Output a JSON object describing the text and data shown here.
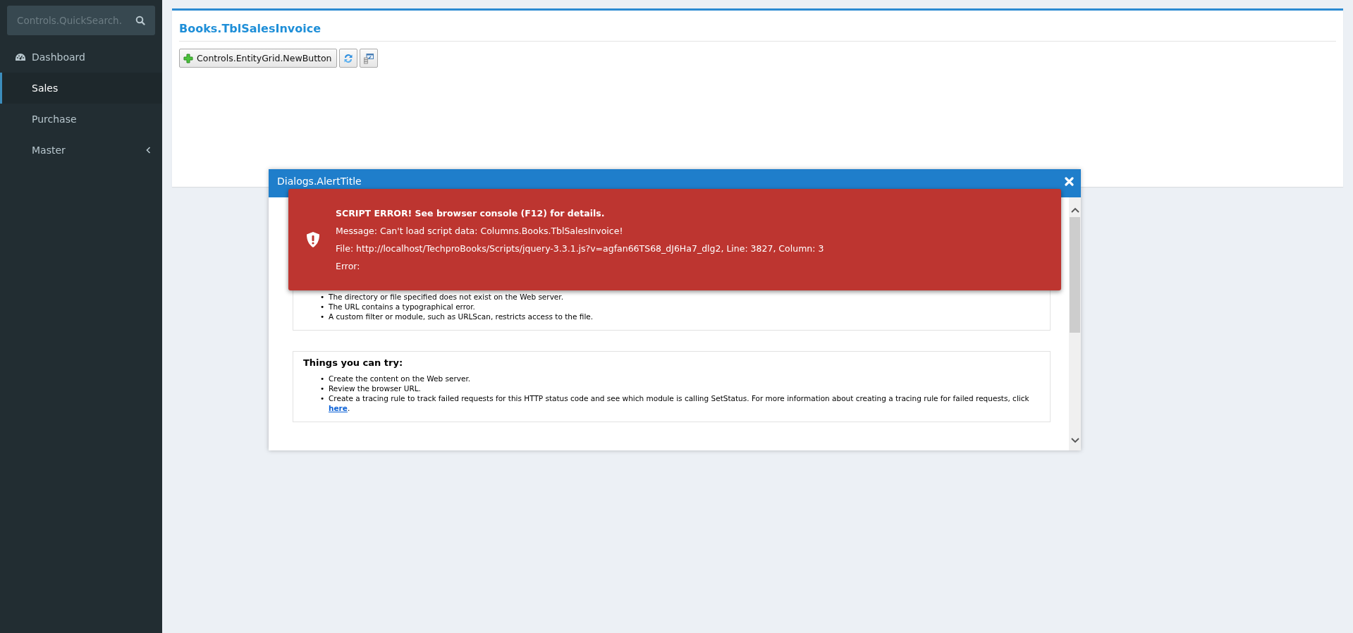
{
  "sidebar": {
    "search": {
      "placeholder": "Controls.QuickSearch."
    },
    "items": [
      {
        "kind": "dashboard",
        "label": "Dashboard",
        "selected": false
      },
      {
        "kind": "link",
        "label": "Sales",
        "selected": true
      },
      {
        "kind": "link",
        "label": "Purchase",
        "selected": false
      },
      {
        "kind": "submenu",
        "label": "Master",
        "selected": false,
        "expanded": false
      }
    ]
  },
  "panel": {
    "title": "Books.TblSalesInvoice",
    "toolbar": [
      {
        "kind": "new",
        "label": "Controls.EntityGrid.NewButton"
      },
      {
        "kind": "refresh"
      },
      {
        "kind": "columns"
      }
    ]
  },
  "dialog": {
    "title": "Dialogs.AlertTitle",
    "sections": [
      {
        "marker": "•",
        "items": [
          {
            "text": "The directory or file specified does not exist on the Web server."
          },
          {
            "text": "The URL contains a typographical error."
          },
          {
            "text": "A custom filter or module, such as URLScan, restricts access to the file."
          }
        ]
      },
      {
        "heading": "Things you can try:",
        "marker": "•",
        "items": [
          {
            "text": "Create the content on the Web server."
          },
          {
            "text": "Review the browser URL."
          },
          {
            "text": "Create a tracing rule to track failed requests for this HTTP status code and see which module is calling SetStatus. For more information about creating a tracing rule for failed requests, click ",
            "link": "here",
            "after": "."
          }
        ]
      }
    ]
  },
  "toast": {
    "kind": "error",
    "title": "SCRIPT ERROR! See browser console (F12) for details.",
    "lines": [
      "Message: Can't load script data: Columns.Books.TblSalesInvoice!",
      "File: http://localhost/TechproBooks/Scripts/jquery-3.3.1.js?v=agfan66TS68_dJ6Ha7_dlg2, Line: 3827, Column: 3",
      "Error:"
    ]
  }
}
